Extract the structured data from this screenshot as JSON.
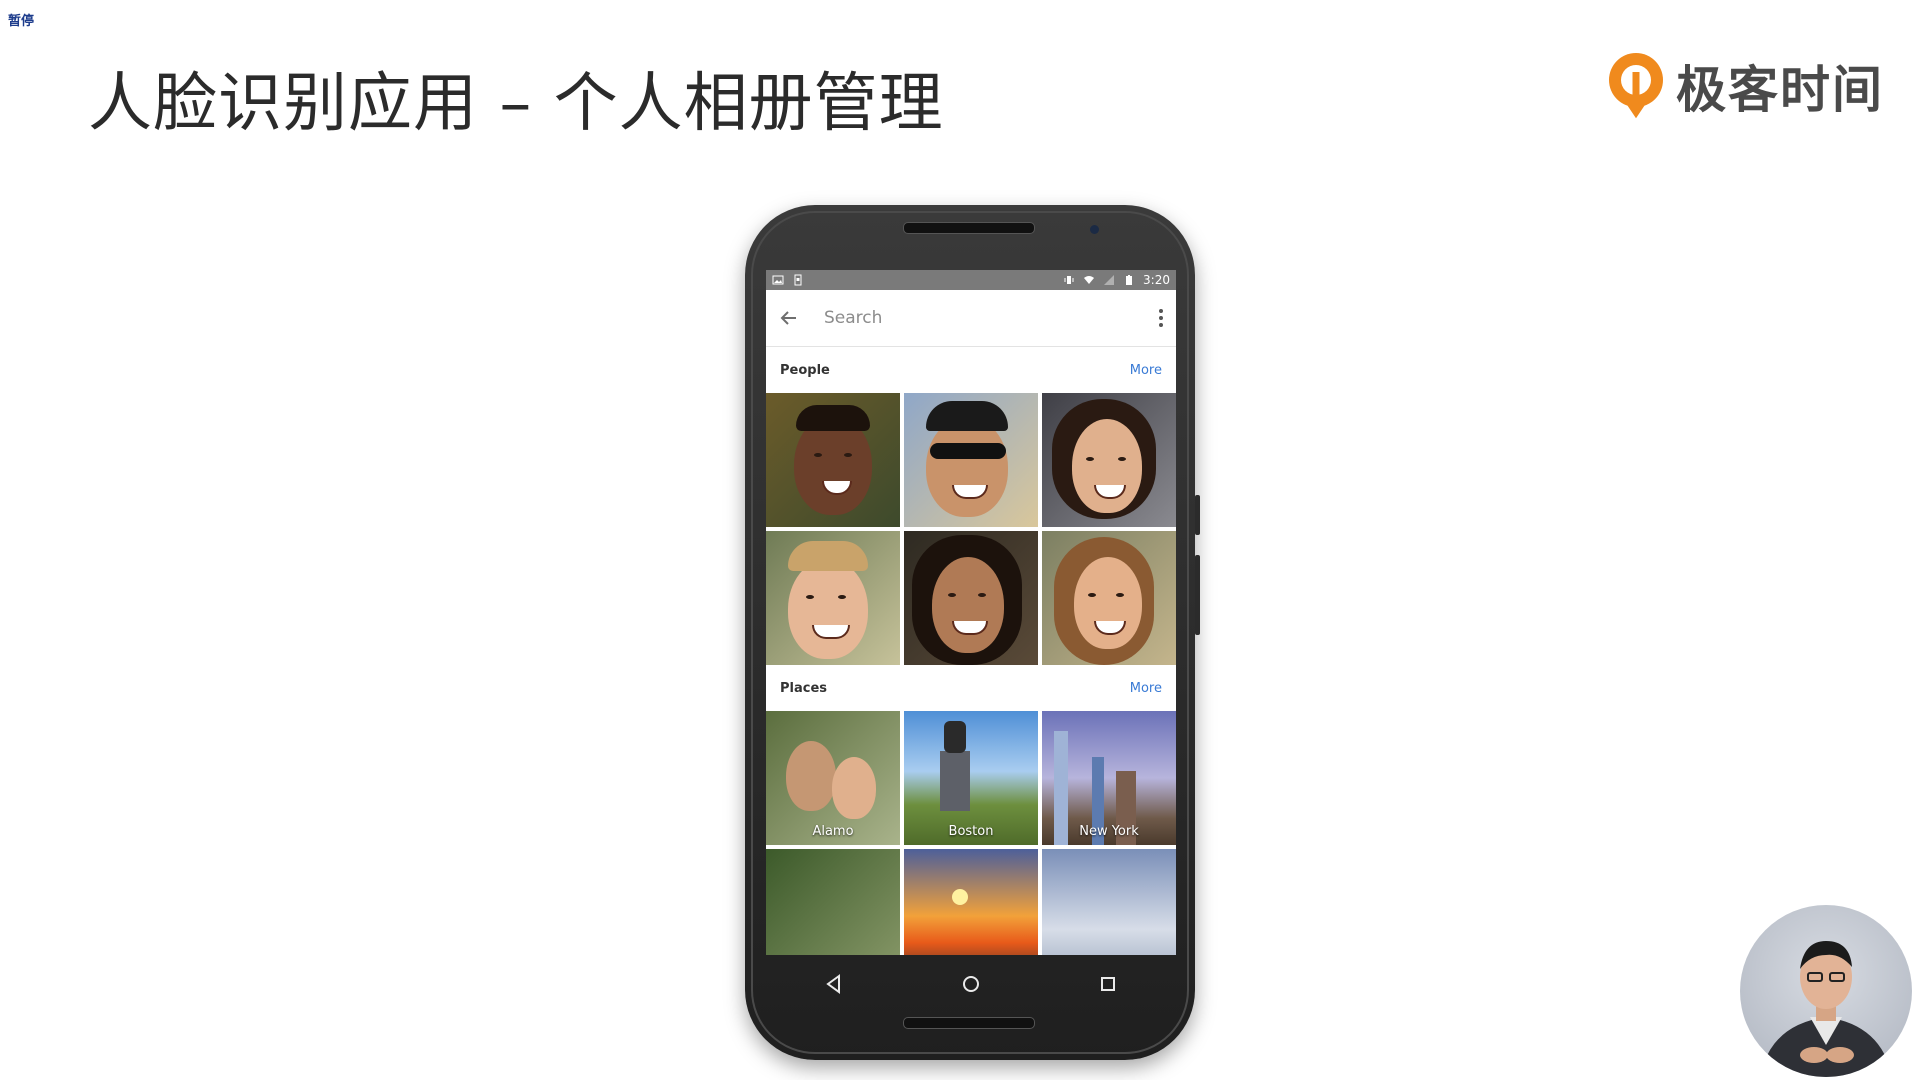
{
  "overlay": {
    "pause_label": "暂停"
  },
  "slide": {
    "title": "人脸识别应用 – 个人相册管理"
  },
  "brand": {
    "name": "极客时间",
    "logo_icon": "geektime-logo-icon",
    "logo_color": "#f08a1d"
  },
  "phone": {
    "status_bar": {
      "time": "3:20",
      "icons": [
        "image-icon",
        "sim-icon",
        "vibrate-icon",
        "wifi-icon",
        "no-signal-icon",
        "battery-icon"
      ]
    },
    "search": {
      "placeholder": "Search",
      "back_icon": "arrow-left-icon",
      "menu_icon": "more-vert-icon"
    },
    "people": {
      "header": "People",
      "more_label": "More",
      "tiles": [
        "person-1",
        "person-2",
        "person-3",
        "person-4",
        "person-5",
        "person-6"
      ]
    },
    "places": {
      "header": "Places",
      "more_label": "More",
      "tiles": [
        {
          "label": "Alamo"
        },
        {
          "label": "Boston"
        },
        {
          "label": "New York"
        },
        {
          "label": ""
        },
        {
          "label": ""
        },
        {
          "label": ""
        }
      ]
    },
    "nav": [
      "back-triangle-icon",
      "home-circle-icon",
      "recents-square-icon"
    ]
  },
  "colors": {
    "link": "#3a7bd5",
    "status_bar": "#7a7a7a"
  }
}
